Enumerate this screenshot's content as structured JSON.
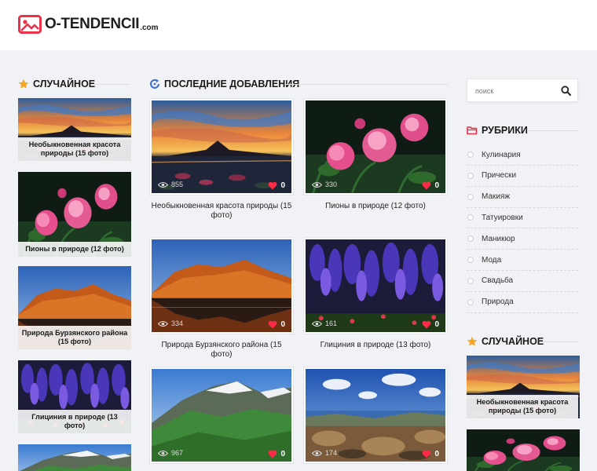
{
  "logo": {
    "text": "O-TENDENCII",
    "domain": ".com"
  },
  "left": {
    "title": "Случайное",
    "cards": [
      {
        "caption": "Необыкновенная красота природы (15 фото)",
        "scene": "sunset"
      },
      {
        "caption": "Пионы в природе (12 фото)",
        "scene": "peony"
      },
      {
        "caption": "Природа Бурзянского района (15 фото)",
        "scene": "mountain-lake"
      },
      {
        "caption": "Глициния в природе (13 фото)",
        "scene": "wisteria"
      },
      {
        "caption": "",
        "scene": "green-mountains"
      }
    ]
  },
  "main": {
    "title": "Последние добавления",
    "posts": [
      {
        "title": "Необыкновенная красота природы (15 фото)",
        "views": "855",
        "likes": "0",
        "scene": "sunset"
      },
      {
        "title": "Пионы в природе (12 фото)",
        "views": "330",
        "likes": "0",
        "scene": "peony"
      },
      {
        "title": "Природа Бурзянского района (15 фото)",
        "views": "334",
        "likes": "0",
        "scene": "mountain-lake"
      },
      {
        "title": "Глициния в природе (13 фото)",
        "views": "161",
        "likes": "0",
        "scene": "wisteria"
      },
      {
        "title": "",
        "views": "967",
        "likes": "0",
        "scene": "green-mountains"
      },
      {
        "title": "",
        "views": "174",
        "likes": "0",
        "scene": "coast"
      }
    ]
  },
  "sidebar": {
    "search_placeholder": "поиск",
    "rubrics_title": "Рубрики",
    "rubrics": [
      "Кулинария",
      "Прически",
      "Макияж",
      "Татуировки",
      "Маникюр",
      "Мода",
      "Свадьба",
      "Природа"
    ],
    "random_title": "Случайное",
    "random_cards": [
      {
        "caption": "Необыкновенная красота природы (15 фото)",
        "scene": "sunset"
      },
      {
        "caption": "",
        "scene": "peony"
      }
    ]
  },
  "colors": {
    "accent": "#e8334a",
    "star": "#f5a623",
    "folder": "#e8334a",
    "refresh": "#3a6fd8",
    "heart": "#ff2a45"
  }
}
